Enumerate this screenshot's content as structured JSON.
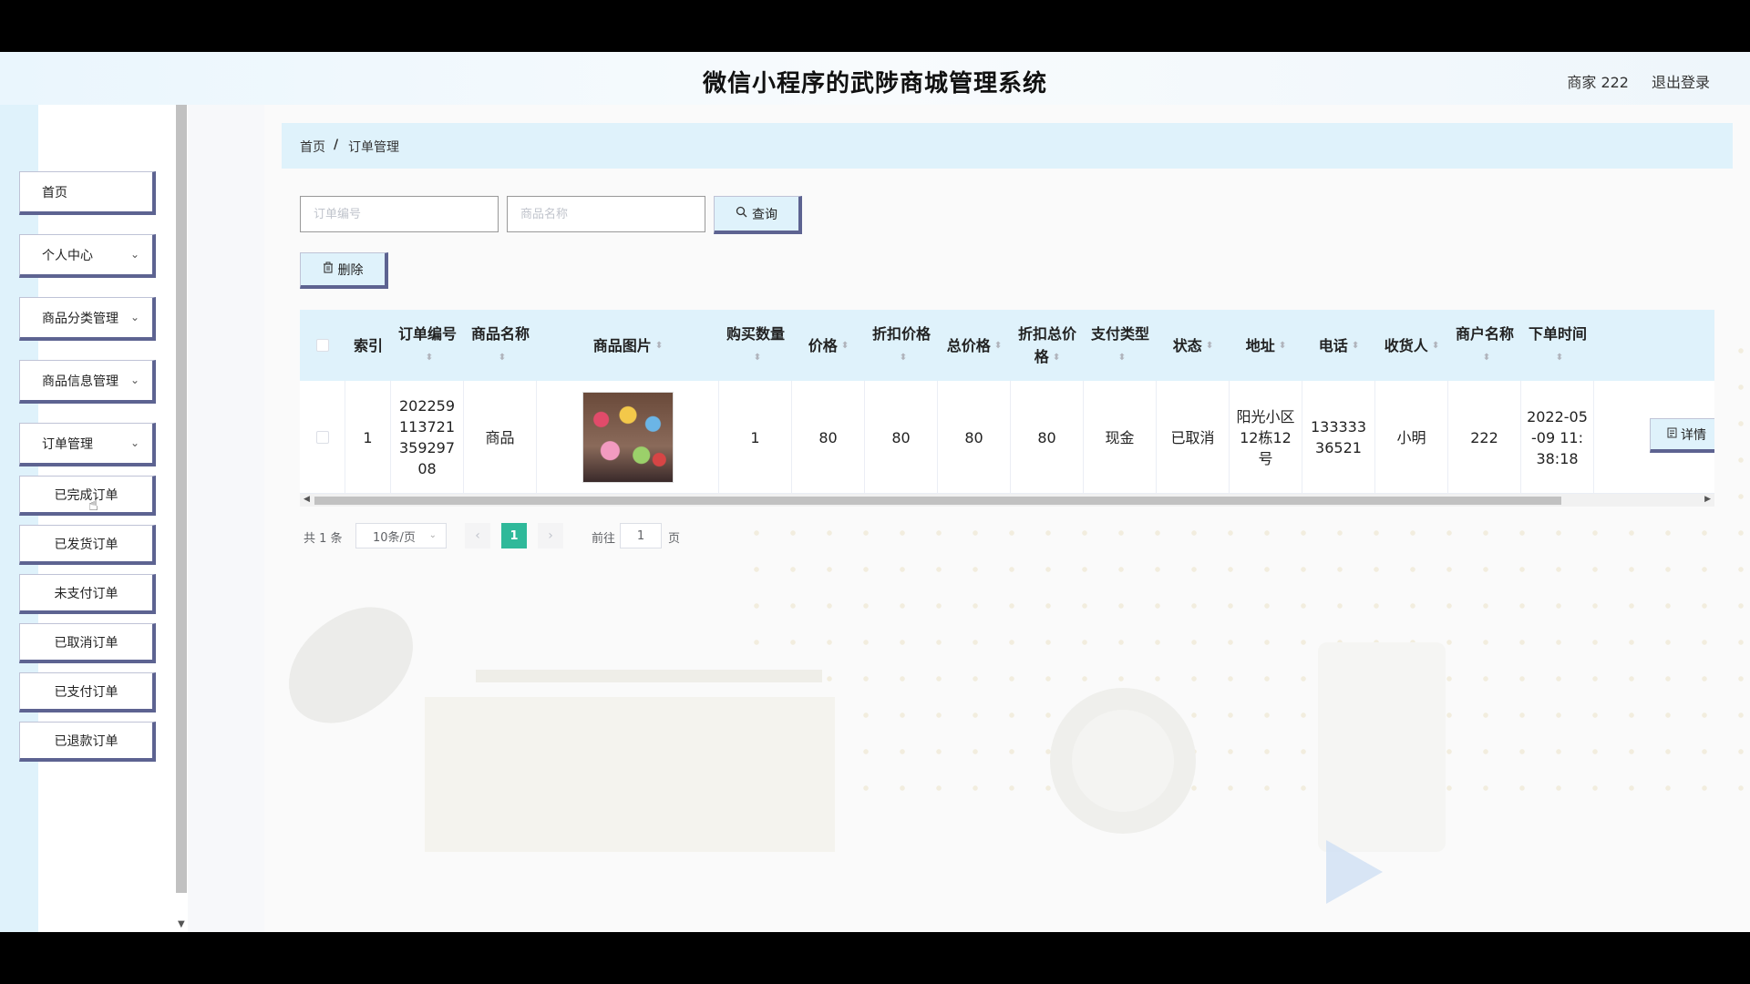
{
  "header": {
    "title": "微信小程序的武陟商城管理系统",
    "user": "商家 222",
    "logout": "退出登录"
  },
  "sidebar": {
    "items": [
      {
        "label": "首页",
        "has_chevron": false
      },
      {
        "label": "个人中心",
        "has_chevron": true
      },
      {
        "label": "商品分类管理",
        "has_chevron": true
      },
      {
        "label": "商品信息管理",
        "has_chevron": true
      },
      {
        "label": "订单管理",
        "has_chevron": true
      }
    ],
    "sub_items": [
      "已完成订单",
      "已发货订单",
      "未支付订单",
      "已取消订单",
      "已支付订单",
      "已退款订单"
    ]
  },
  "breadcrumb": {
    "home": "首页",
    "separator": "/",
    "current": "订单管理"
  },
  "search": {
    "order_no_placeholder": "订单编号",
    "product_name_placeholder": "商品名称",
    "button": "查询"
  },
  "actions": {
    "delete": "删除"
  },
  "table": {
    "columns": [
      "索引",
      "订单编号",
      "商品名称",
      "商品图片",
      "购买数量",
      "价格",
      "折扣价格",
      "总价格",
      "折扣总价格",
      "支付类型",
      "状态",
      "地址",
      "电话",
      "收货人",
      "商户名称",
      "下单时间"
    ],
    "rows": [
      {
        "index": "1",
        "order_no": "20225911372135929708",
        "product_name": "商品",
        "quantity": "1",
        "price": "80",
        "discount_price": "80",
        "total_price": "80",
        "discount_total": "80",
        "pay_type": "现金",
        "status": "已取消",
        "address": "阳光小区12栋12号",
        "phone": "13333336521",
        "receiver": "小明",
        "merchant": "222",
        "order_time": "2022-05-09 11:38:18",
        "detail_label": "详情"
      }
    ]
  },
  "pagination": {
    "total": "共 1 条",
    "page_size": "10条/页",
    "current_page": "1",
    "goto_label": "前往",
    "goto_value": "1",
    "page_unit": "页"
  },
  "icons": {
    "sort": "sort-caret-icon",
    "search": "search-icon",
    "delete": "trash-icon",
    "detail": "document-icon",
    "chevron": "chevron-down-icon"
  },
  "colors": {
    "accent_light": "#dff2fb",
    "button_shadow": "#5d6391",
    "pager_active": "#2fb99a"
  }
}
